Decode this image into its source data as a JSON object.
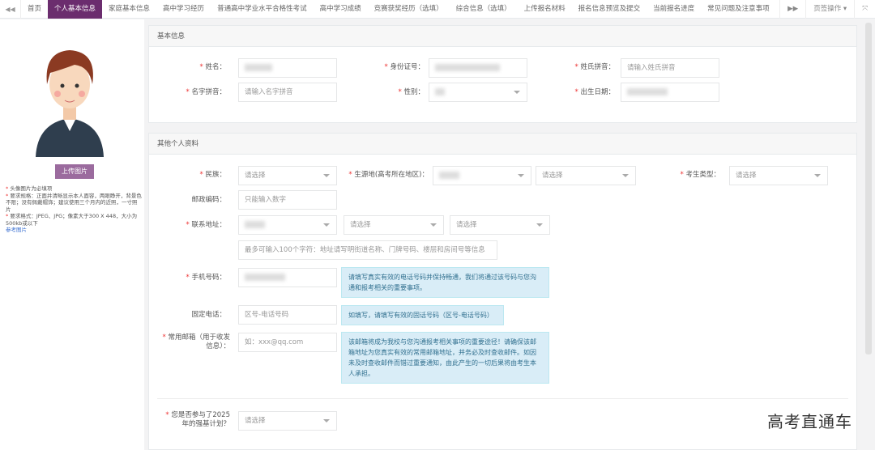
{
  "tabs": [
    "首页",
    "个人基本信息",
    "家庭基本信息",
    "高中学习经历",
    "普通高中学业水平合格性考试",
    "高中学习成绩",
    "竞赛获奖经历（选填）",
    "综合信息（选填）",
    "上传报名材料",
    "报名信息预览及提交",
    "当前报名进度",
    "常见问题及注意事项"
  ],
  "tab_ops": "页签操作 ▾",
  "sidebar": {
    "upload_label": "上传图片",
    "notes": [
      "头像图片为必填项",
      "要求规格：正面并清晰显示本人面容，两眼睁开，背景色不限；没有佩戴帽饰；建议使用三个月内的近照，一寸照片",
      "要求格式：JPEG、JPG；像素大于300 X 448，大小为500kb或以下"
    ],
    "ref_link": "参考图片"
  },
  "basic": {
    "title": "基本信息",
    "name": "姓名：",
    "id": "身份证号：",
    "surname_py": "姓氏拼音：",
    "surname_py_ph": "请输入姓氏拼音",
    "given_py": "名字拼音：",
    "given_py_ph": "请输入名字拼音",
    "gender": "性别：",
    "birth": "出生日期："
  },
  "other": {
    "title": "其他个人资料",
    "ethnic": "民族：",
    "select": "请选择",
    "origin": "生源地(高考所在地区)：",
    "type": "考生类型：",
    "postal": "邮政编码：",
    "postal_ph": "只能输入数字",
    "address": "联系地址：",
    "address_ph": "最多可输入100个字符：地址请写明街道名称、门牌号码、楼层和房间号等信息",
    "mobile": "手机号码：",
    "mobile_tip": "请填写真实有效的电话号码并保持畅通，我们将通过该号码与您沟通和报考相关的重要事项。",
    "phone": "固定电话：",
    "phone_ph": "区号-电话号码",
    "phone_tip": "如填写，请填写有效的固话号码（区号-电话号码）",
    "email": "常用邮箱（用于收发信息）：",
    "email_ph": "如：xxx@qq.com",
    "email_tip": "该邮箱将成为我校与您沟通报考相关事项的重要途径！请确保该邮箱地址为您真实有效的常用邮箱地址，并务必及时查收邮件。如因未及时查收邮件而错过重要通知，由此产生的一切后果将由考生本人承担。",
    "plan": "您是否参与了2025年的强基计划？"
  },
  "watermark": "高考直通车"
}
